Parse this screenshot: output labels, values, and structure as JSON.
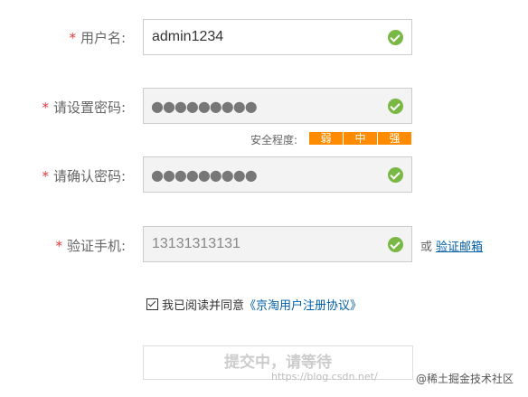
{
  "form": {
    "username": {
      "required_mark": "*",
      "label": "用户名:",
      "value": "admin1234",
      "valid": true
    },
    "password": {
      "required_mark": "*",
      "label": "请设置密码:",
      "value": "●●●●●●●●●",
      "valid": true
    },
    "strength": {
      "label": "安全程度:",
      "levels": [
        "弱",
        "中",
        "强"
      ],
      "bar_color": "#ff8c00"
    },
    "confirm_password": {
      "required_mark": "*",
      "label": "请确认密码:",
      "value": "●●●●●●●●●",
      "valid": true
    },
    "phone": {
      "required_mark": "*",
      "label": "验证手机:",
      "value": "13131313131",
      "valid": true,
      "or_text": "或",
      "email_link": "验证邮箱"
    },
    "agreement": {
      "checked": true,
      "text": "我已阅读并同意",
      "link": "《京淘用户注册协议》"
    },
    "submit_label": "提交中，请等待"
  },
  "watermark": {
    "url": "https://blog.csdn.net/",
    "brand": "@稀土掘金技术社区"
  },
  "colors": {
    "required": "#e4393c",
    "valid_check": "#7ab846",
    "link": "#005ea7"
  },
  "icons": {
    "valid": "check-circle-icon",
    "agree_checkbox": "checkbox-checked-icon"
  }
}
